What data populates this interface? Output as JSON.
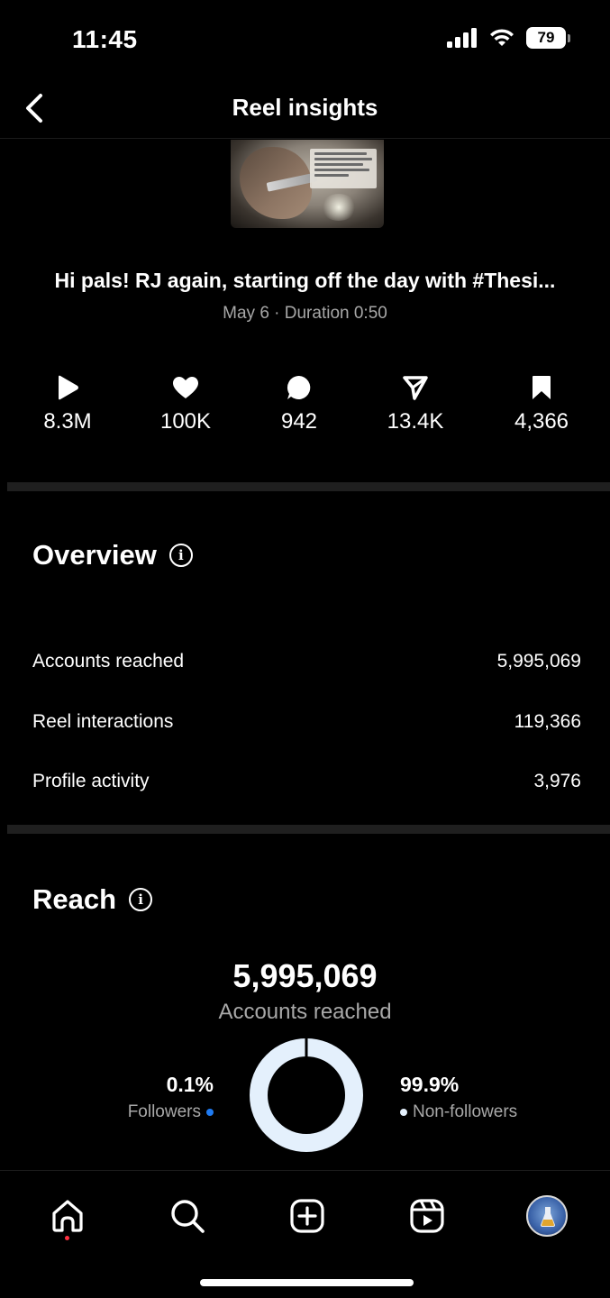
{
  "status_bar": {
    "time": "11:45",
    "battery": "79"
  },
  "header": {
    "title": "Reel insights"
  },
  "reel": {
    "caption": "Hi pals! RJ again, starting off the day with #Thesi...",
    "meta": "May 6 · Duration 0:50"
  },
  "stats": {
    "plays": "8.3M",
    "likes": "100K",
    "comments": "942",
    "shares": "13.4K",
    "saves": "4,366"
  },
  "overview": {
    "title": "Overview",
    "rows": [
      {
        "label": "Accounts reached",
        "value": "5,995,069"
      },
      {
        "label": "Reel interactions",
        "value": "119,366"
      },
      {
        "label": "Profile activity",
        "value": "3,976"
      }
    ]
  },
  "reach": {
    "title": "Reach",
    "total": "5,995,069",
    "total_label": "Accounts reached",
    "followers_pct": "0.1%",
    "followers_label": "Followers",
    "non_followers_pct": "99.9%",
    "non_followers_label": "Non-followers",
    "followers_fraction": 0.001,
    "followers_color": "#1f7bf2",
    "non_followers_color": "#e4f0fc"
  },
  "tabs": {
    "icons": [
      "home-icon",
      "search-icon",
      "create-icon",
      "reels-icon",
      "profile-avatar"
    ]
  }
}
